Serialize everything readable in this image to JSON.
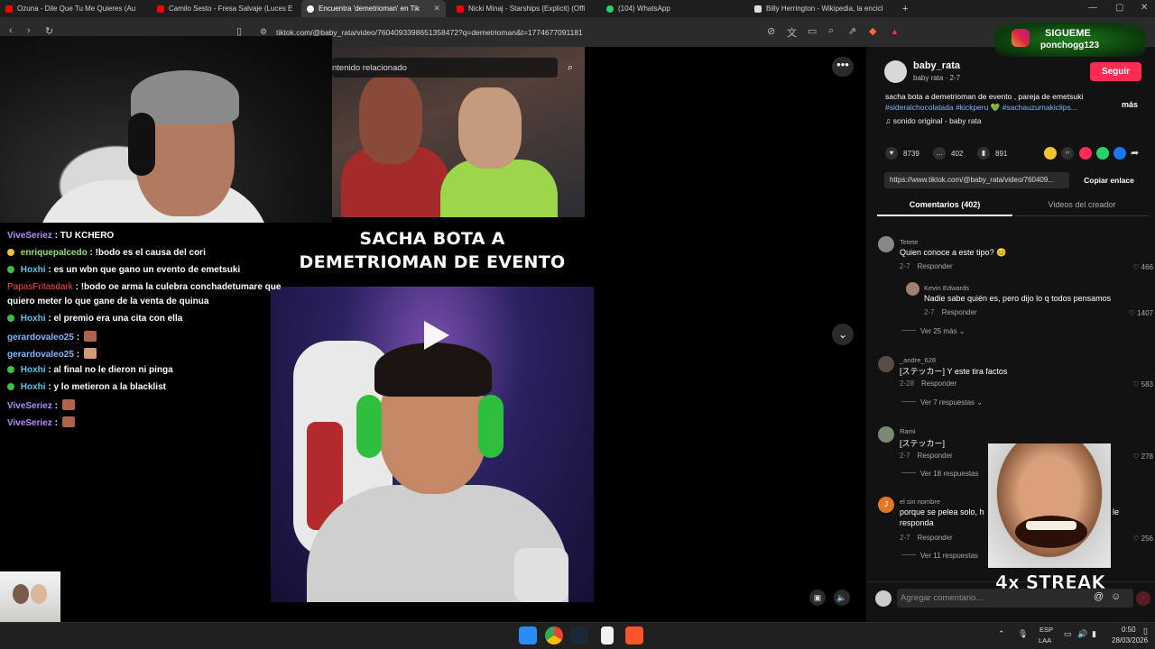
{
  "browser": {
    "tabs": [
      {
        "label": "Ozuna - Dile Que Tu Me Quieres (Au",
        "color": "#ff0000"
      },
      {
        "label": "Camilo Sesto - Fresa Salvaje (Luces E",
        "color": "#ff0000"
      },
      {
        "label": "Encuentra 'demetrioman' en Tik",
        "color": "#ffffff",
        "active": true
      },
      {
        "label": "Nicki Minaj - Starships (Explicit) (Offi",
        "color": "#ff0000"
      },
      {
        "label": "(104) WhatsApp",
        "color": "#25d366"
      },
      {
        "label": "Billy Herrington - Wikipedia, la encicl",
        "color": "#dddddd"
      }
    ],
    "new_tab": "+",
    "url": "tiktok.com/@baby_rata/video/7604093398651358472?q=demetrioman&t=1774677091181"
  },
  "chat": {
    "lines": [
      {
        "user": "ViveSeriez",
        "msg": "TU KCHERO",
        "color": "purple"
      },
      {
        "user": "enriquepalcedo",
        "msg": "!bodo es el causa del cori",
        "color": "green"
      },
      {
        "user": "Hoxhi",
        "msg": "es un wbn que gano un evento de emetsuki",
        "color": "blue"
      },
      {
        "user": "PapasFritasdark",
        "msg": "!bodo oe arma la culebra conchadetumare que",
        "msg2": "quiero meter lo que gane de la venta de quinua",
        "color": "red"
      },
      {
        "user": "Hoxhi",
        "msg": "el premio era una cita con ella",
        "color": "blue"
      },
      {
        "user": "gerardovaleo25",
        "msg": "",
        "color": "blue"
      },
      {
        "user": "gerardovaleo25",
        "msg": "",
        "color": "blue"
      },
      {
        "user": "Hoxhi",
        "msg": "al final no le dieron ni pinga",
        "color": "blue"
      },
      {
        "user": "Hoxhi",
        "msg": "y lo metieron a la blacklist",
        "color": "blue"
      },
      {
        "user": "ViveSeriez",
        "msg": "",
        "color": "purple"
      },
      {
        "user": "ViveSeriez",
        "msg": "",
        "color": "purple"
      }
    ],
    "separator": ":"
  },
  "video": {
    "related_search": "ntenido relacionado",
    "caption_line1": "SACHA BOTA A",
    "caption_line2": "DEMETRIOMAN DE EVENTO",
    "more": "•••"
  },
  "post": {
    "author_name": "baby_rata",
    "author_sub": "baby rata · 2-7",
    "follow": "Seguir",
    "desc_text": "sacha bota a demetrioman de evento , pareja de emetsuki",
    "desc_tags": "#sideralchocolatada #kickperu 💚 #sachauzumakiclips...",
    "more": "más",
    "sound": "♫  sonido original - baby rata",
    "likes": "8739",
    "comments": "402",
    "saves": "891",
    "link": "https://www.tiktok.com/@baby_rata/video/760409...",
    "copy_link": "Copiar enlace",
    "tab_comments": "Comentarios (402)",
    "tab_videos": "Videos del creador"
  },
  "comments": [
    {
      "user": "Tetete",
      "text": "Quien conoce a este tipo? 😊",
      "date": "2-7",
      "reply": "Responder",
      "likes": "466"
    },
    {
      "user": "Kevin Edwards",
      "text": "Nadie sabe quién es, pero dijo lo q todos pensamos",
      "date": "2-7",
      "reply": "Responder",
      "likes": "1407"
    },
    {
      "more": "Ver 25 más ⌄"
    },
    {
      "user": "_andre_628",
      "text": "[ステッカー] Y este tira factos",
      "date": "2-28",
      "reply": "Responder",
      "likes": "583"
    },
    {
      "more": "Ver 7 respuestas ⌄"
    },
    {
      "user": "Rami",
      "text": "[ステッカー]",
      "date": "2-7",
      "reply": "Responder",
      "likes": "278"
    },
    {
      "more": "Ver 18 respuestas"
    },
    {
      "user": "el sin nombre",
      "text": "porque se pelea solo, h",
      "text_end": "le",
      "text2": "responda",
      "date": "2-7",
      "reply": "Responder",
      "likes": "256"
    },
    {
      "more": "Ver 11 respuestas"
    }
  ],
  "comment_box": {
    "placeholder": "Agregar comentario...",
    "at": "@",
    "emoji": "☺"
  },
  "overlay": {
    "follow_label": "SIGUEME",
    "follow_handle": "ponchogg123",
    "streak": "4x STREAK"
  },
  "taskbar": {
    "lang1": "ESP",
    "lang2": "LAA",
    "time": "0:50",
    "date": "28/03/2026"
  }
}
